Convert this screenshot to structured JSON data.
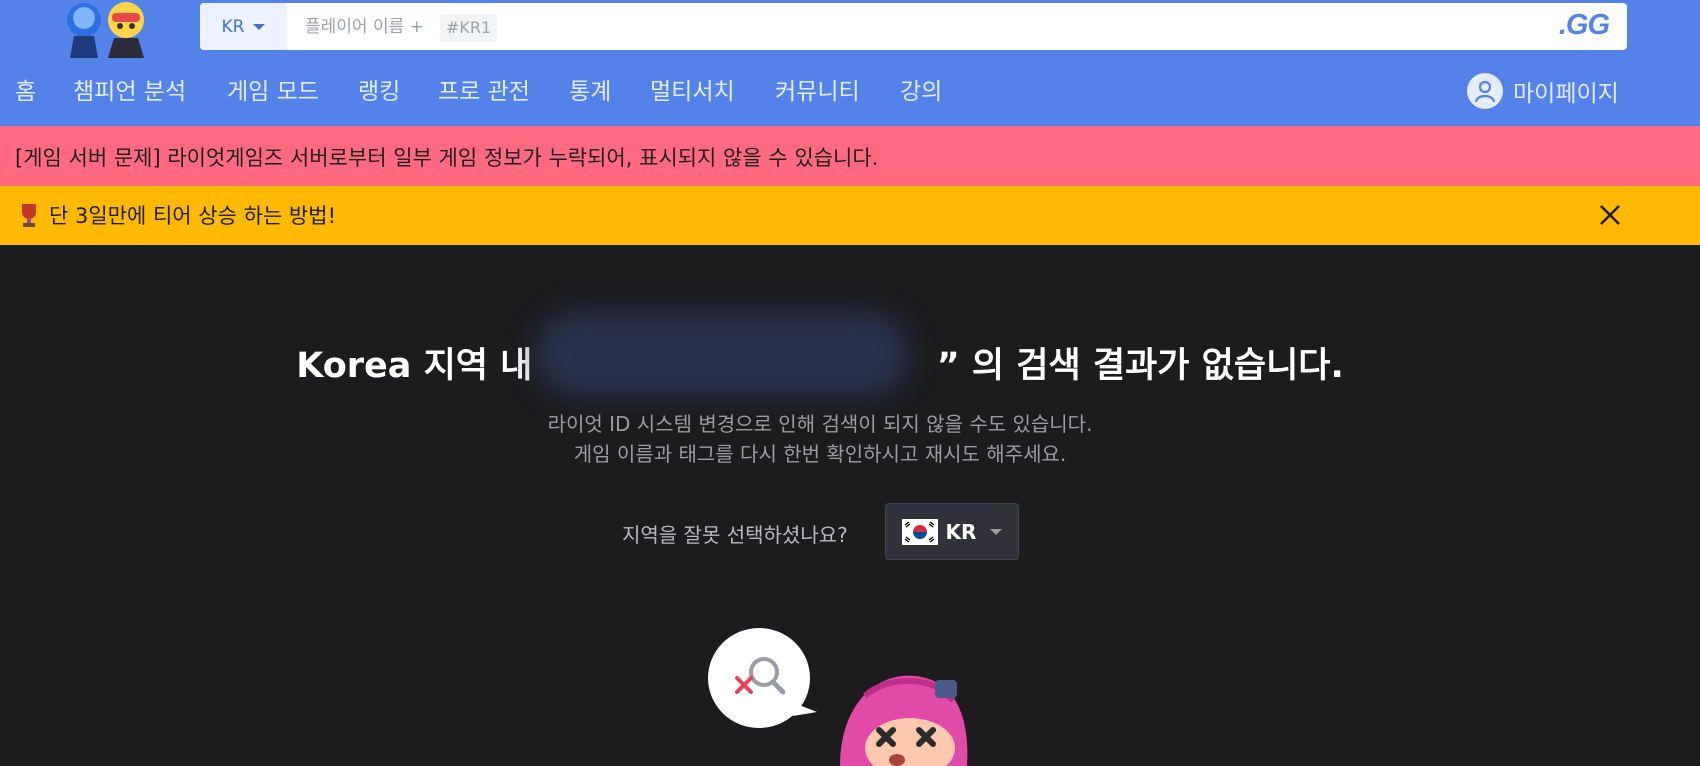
{
  "header": {
    "search": {
      "region": "KR",
      "placeholder": "플레이어 이름 +",
      "tag_hint": "#KR1",
      "submit_label": ".GG"
    },
    "nav": [
      {
        "label": "홈"
      },
      {
        "label": "챔피언 분석"
      },
      {
        "label": "게임 모드"
      },
      {
        "label": "랭킹"
      },
      {
        "label": "프로 관전"
      },
      {
        "label": "통계"
      },
      {
        "label": "멀티서치"
      },
      {
        "label": "커뮤니티"
      },
      {
        "label": "강의"
      }
    ],
    "mypage_label": "마이페이지"
  },
  "banners": {
    "notice": "[게임 서버 문제] 라이엇게임즈 서버로부터 일부 게임 정보가 누락되어, 표시되지 않을 수 있습니다.",
    "promo": "단 3일만에 티어 상승 하는 방법!"
  },
  "result": {
    "title_prefix": "Korea 지역 내",
    "title_suffix": "” 의 검색 결과가 없습니다.",
    "line1": "라이엇 ID 시스템 변경으로 인해 검색이 되지 않을 수도 있습니다.",
    "line2": "게임 이름과 태그를 다시 한번 확인하시고 재시도 해주세요.",
    "region_question": "지역을 잘못 선택하셨나요?",
    "region_value": "KR"
  },
  "colors": {
    "header": "#5383e8",
    "notice_bg": "#ff6a80",
    "promo_bg": "#ffb900",
    "page_bg": "#1c1c1f"
  }
}
